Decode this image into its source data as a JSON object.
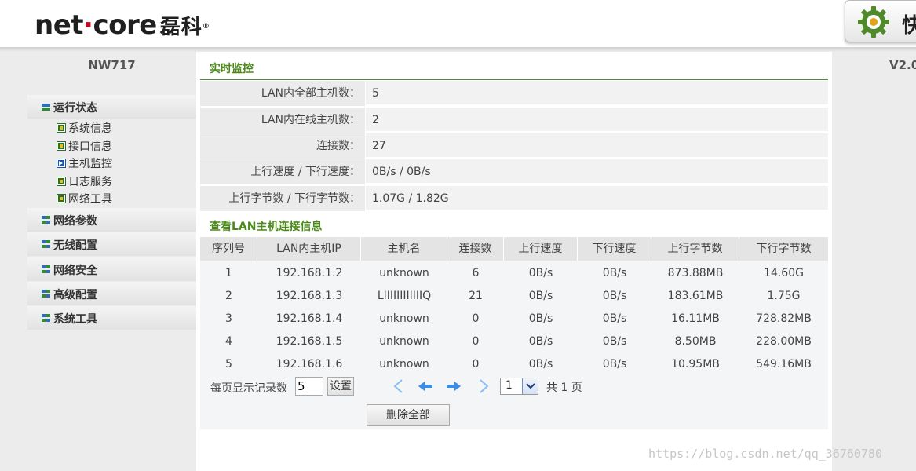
{
  "header": {
    "logo_text_a": "net",
    "logo_dot": "·",
    "logo_text_b": "core",
    "logo_cn": "磊科",
    "logo_reg": "®",
    "quick_label": "快",
    "quick_icon": "gear-icon"
  },
  "sidebar": {
    "model": "NW717",
    "groups": [
      {
        "label": "运行状态",
        "expanded": true,
        "items": [
          {
            "label": "系统信息",
            "active": false
          },
          {
            "label": "接口信息",
            "active": false
          },
          {
            "label": "主机监控",
            "active": true
          },
          {
            "label": "日志服务",
            "active": false
          },
          {
            "label": "网络工具",
            "active": false
          }
        ]
      },
      {
        "label": "网络参数"
      },
      {
        "label": "无线配置"
      },
      {
        "label": "网络安全"
      },
      {
        "label": "高级配置"
      },
      {
        "label": "系统工具"
      }
    ]
  },
  "version": "V2.0",
  "monitor": {
    "title": "实时监控",
    "rows": [
      {
        "key": "LAN内全部主机数：",
        "value": "5"
      },
      {
        "key": "LAN内在线主机数：",
        "value": "2"
      },
      {
        "key": "连接数：",
        "value": "27"
      },
      {
        "key": "上行速度 / 下行速度：",
        "value": "0B/s / 0B/s"
      },
      {
        "key": "上行字节数 / 下行字节数：",
        "value": "1.07G / 1.82G"
      }
    ]
  },
  "connections": {
    "title": "查看LAN主机连接信息",
    "columns": [
      "序列号",
      "LAN内主机IP",
      "主机名",
      "连接数",
      "上行速度",
      "下行速度",
      "上行字节数",
      "下行字节数"
    ],
    "rows": [
      [
        "1",
        "192.168.1.2",
        "unknown",
        "6",
        "0B/s",
        "0B/s",
        "873.88MB",
        "14.60G"
      ],
      [
        "2",
        "192.168.1.3",
        "LIIIIIIIIIIIIQ",
        "21",
        "0B/s",
        "0B/s",
        "183.61MB",
        "1.75G"
      ],
      [
        "3",
        "192.168.1.4",
        "unknown",
        "0",
        "0B/s",
        "0B/s",
        "16.11MB",
        "728.82MB"
      ],
      [
        "4",
        "192.168.1.5",
        "unknown",
        "0",
        "0B/s",
        "0B/s",
        "8.50MB",
        "228.00MB"
      ],
      [
        "5",
        "192.168.1.6",
        "unknown",
        "0",
        "0B/s",
        "0B/s",
        "10.95MB",
        "549.16MB"
      ]
    ],
    "pager": {
      "per_page_label": "每页显示记录数",
      "per_page_value": "5",
      "set_label": "设置",
      "page_value": "1",
      "total_label": "共 1 页",
      "delete_all_label": "删除全部"
    }
  },
  "watermark": "https://blog.csdn.net/qq_36760780",
  "colors": {
    "accent_green": "#4a8a1a",
    "nav_blue": "#3a8ee6"
  }
}
